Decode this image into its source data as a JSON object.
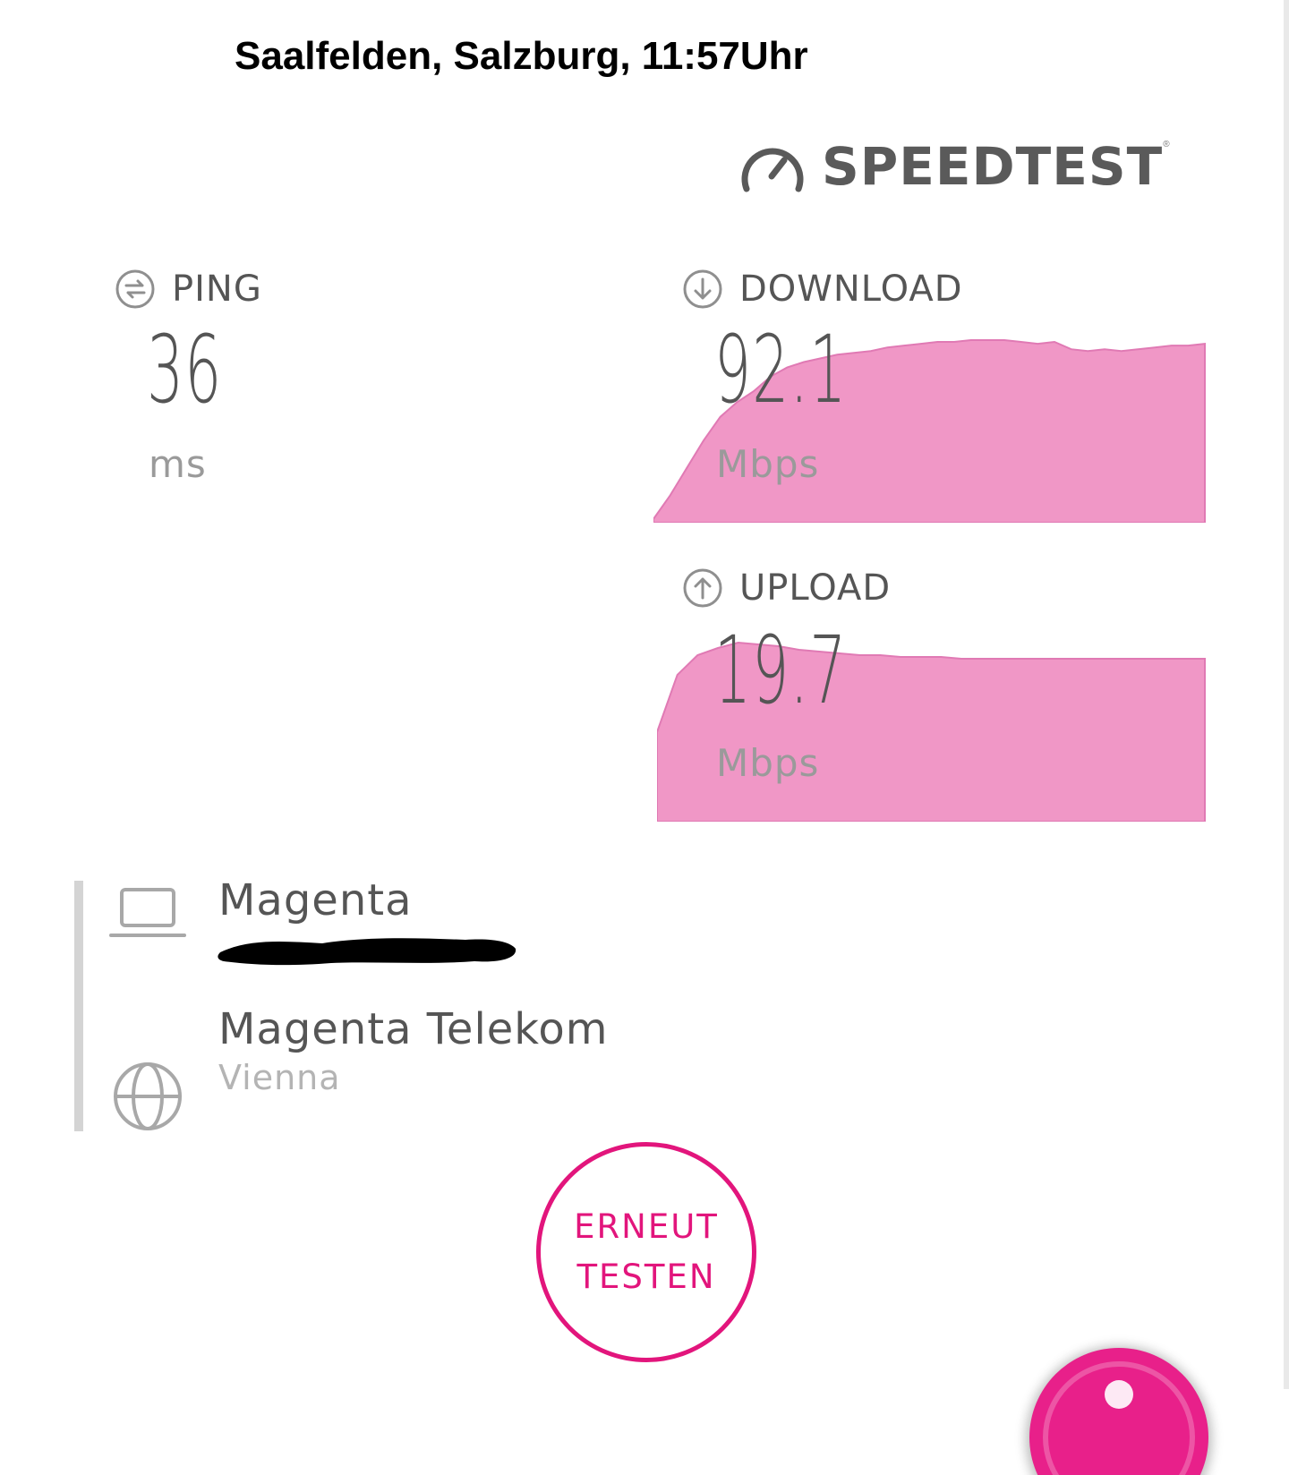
{
  "caption": "Saalfelden, Salzburg, 11:57Uhr",
  "brand": {
    "name": "SPEEDTEST",
    "reg_mark": "®",
    "icon": "speedometer-icon"
  },
  "colors": {
    "accent": "#e2157c",
    "graph_fill": "#f097c6",
    "graph_stroke": "#e07ab4",
    "text": "#555555",
    "muted": "#9a9a9a"
  },
  "ping": {
    "label": "PING",
    "value": "36",
    "unit": "ms",
    "icon": "ping-arrows-icon"
  },
  "download": {
    "label": "DOWNLOAD",
    "value": "92.1",
    "unit": "Mbps",
    "icon": "download-arrow-icon",
    "curve": [
      0.02,
      0.15,
      0.3,
      0.45,
      0.58,
      0.66,
      0.72,
      0.8,
      0.85,
      0.88,
      0.9,
      0.92,
      0.93,
      0.94,
      0.96,
      0.97,
      0.98,
      0.99,
      0.99,
      1.0,
      1.0,
      1.0,
      0.99,
      0.98,
      0.99,
      0.95,
      0.94,
      0.95,
      0.94,
      0.95,
      0.96,
      0.97,
      0.97,
      0.98
    ]
  },
  "upload": {
    "label": "UPLOAD",
    "value": "19.7",
    "unit": "Mbps",
    "icon": "upload-arrow-icon",
    "curve": [
      0.5,
      0.82,
      0.93,
      0.97,
      1.0,
      0.99,
      0.98,
      0.96,
      0.95,
      0.94,
      0.93,
      0.93,
      0.92,
      0.92,
      0.92,
      0.91,
      0.91,
      0.91,
      0.91,
      0.91,
      0.91,
      0.91,
      0.91,
      0.91,
      0.91,
      0.91,
      0.91,
      0.91
    ]
  },
  "connection": {
    "provider": "Magenta",
    "ip": "",
    "provider_icon": "laptop-icon"
  },
  "server": {
    "name": "Magenta Telekom",
    "location": "Vienna",
    "icon": "globe-icon"
  },
  "retest": {
    "line1": "ERNEUT",
    "line2": "TESTEN"
  }
}
